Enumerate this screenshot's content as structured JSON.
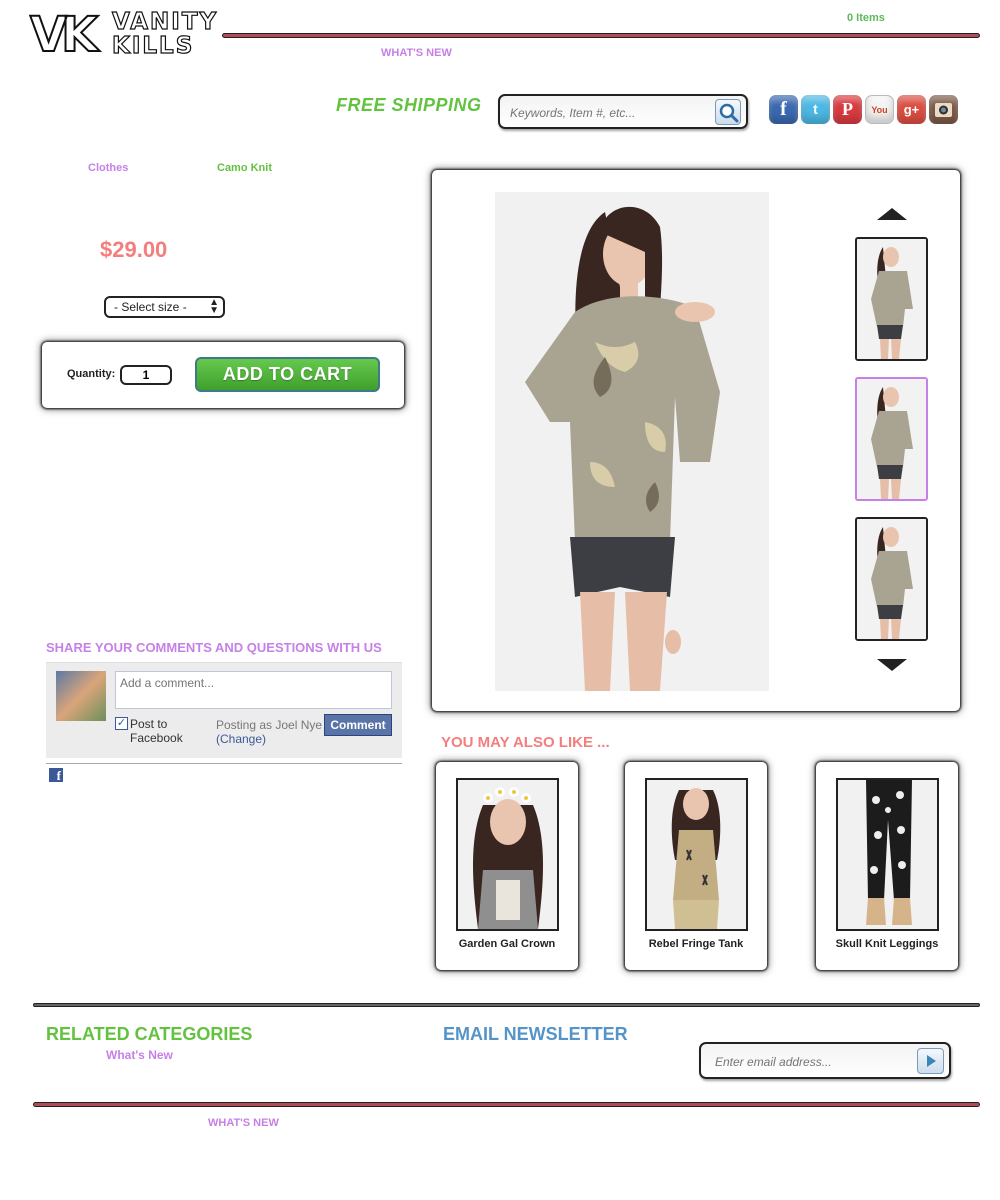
{
  "header": {
    "logo_mark": "VK",
    "logo_line1": "VANITY",
    "logo_line2": "KILLS",
    "cart_count": "0 Items",
    "nav_whats_new": "WHAT'S NEW",
    "free_shipping": "FREE SHIPPING",
    "search_placeholder": "Keywords, Item #, etc...",
    "social_icons": [
      "facebook-icon",
      "twitter-icon",
      "pinterest-icon",
      "youtube-icon",
      "google-plus-icon",
      "instagram-icon"
    ]
  },
  "breadcrumb": {
    "category": "Clothes",
    "product": "Camo Knit"
  },
  "product": {
    "price": "$29.00",
    "size_selected": "- Select size -",
    "quantity_label": "Quantity:",
    "quantity_value": "1",
    "add_to_cart": "ADD TO CART",
    "selected_thumbnail": 2
  },
  "comments": {
    "heading": "SHARE YOUR COMMENTS AND QUESTIONS WITH US",
    "placeholder": "Add a comment...",
    "post_to_facebook": "Post to Facebook",
    "post_checked": true,
    "posting_as": "Posting as Joel Nye",
    "change": "(Change)",
    "comment_button": "Comment"
  },
  "recommendations": {
    "heading": "YOU MAY ALSO LIKE ...",
    "items": [
      {
        "name": "Garden Gal Crown"
      },
      {
        "name": "Rebel Fringe Tank"
      },
      {
        "name": "Skull Knit Leggings"
      }
    ]
  },
  "footer": {
    "related_heading": "RELATED CATEGORIES",
    "related_link": "What's New",
    "newsletter_heading": "EMAIL NEWSLETTER",
    "newsletter_placeholder": "Enter email address...",
    "bottom_whats_new": "WHAT'S NEW"
  },
  "colors": {
    "green": "#63c23f",
    "purple": "#c680e8",
    "pink": "#f47e7e",
    "blue": "#5593c8",
    "facebook": "#3b5998"
  }
}
